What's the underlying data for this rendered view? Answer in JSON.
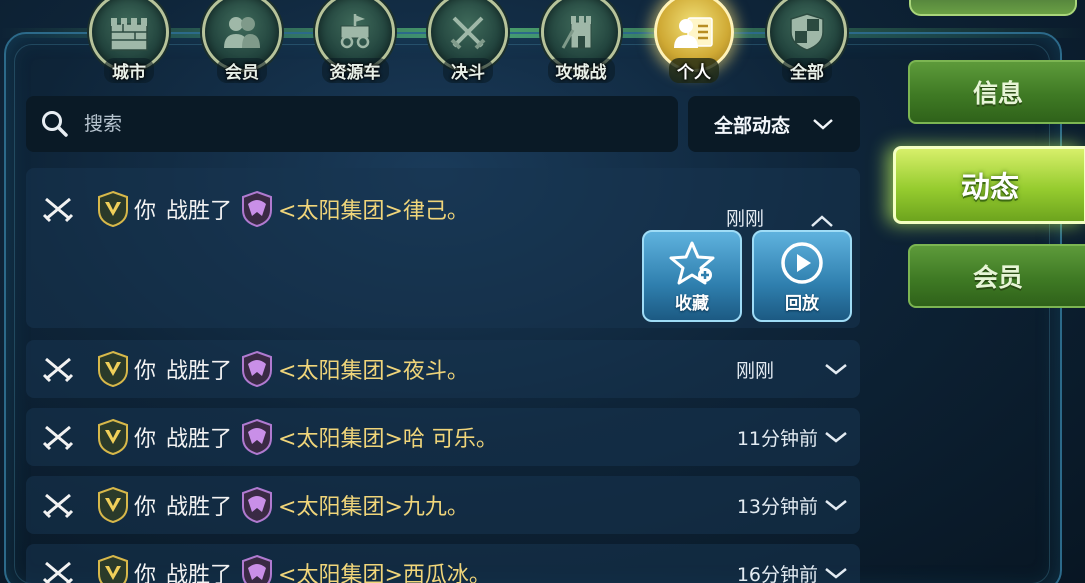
{
  "tabs": [
    {
      "label": "城市",
      "icon": "castle-wall-icon",
      "active": false
    },
    {
      "label": "会员",
      "icon": "members-icon",
      "active": false
    },
    {
      "label": "资源车",
      "icon": "resource-cart-icon",
      "active": false
    },
    {
      "label": "决斗",
      "icon": "crossed-swords-icon",
      "active": false
    },
    {
      "label": "攻城战",
      "icon": "siege-icon",
      "active": false
    },
    {
      "label": "个人",
      "icon": "person-card-icon",
      "active": true
    },
    {
      "label": "全部",
      "icon": "shield-icon",
      "active": false
    }
  ],
  "search": {
    "placeholder": "搜索",
    "value": ""
  },
  "filter": {
    "label": "全部动态"
  },
  "side_menu": [
    {
      "label": "信息",
      "active": false
    },
    {
      "label": "动态",
      "active": true
    },
    {
      "label": "会员",
      "active": false
    }
  ],
  "feed": [
    {
      "subject": "你",
      "verb": "战胜了",
      "target": "<太阳集团>律己。",
      "time": "刚刚",
      "expanded": true
    },
    {
      "subject": "你",
      "verb": "战胜了",
      "target": "<太阳集团>夜斗。",
      "time": "刚刚",
      "expanded": false
    },
    {
      "subject": "你",
      "verb": "战胜了",
      "target": "<太阳集团>哈 可乐。",
      "time": "11分钟前",
      "expanded": false
    },
    {
      "subject": "你",
      "verb": "战胜了",
      "target": "<太阳集团>九九。",
      "time": "13分钟前",
      "expanded": false
    },
    {
      "subject": "你",
      "verb": "战胜了",
      "target": "<太阳集团>西瓜冰。",
      "time": "16分钟前",
      "expanded": false
    }
  ],
  "actions": {
    "favorite_label": "收藏",
    "replay_label": "回放"
  },
  "colors": {
    "active_tab": "#cfa934",
    "side_active": "#96cc2f",
    "side_idle": "#3f7a24",
    "action_button": "#2f7fae",
    "target_name": "#f0d57a"
  }
}
